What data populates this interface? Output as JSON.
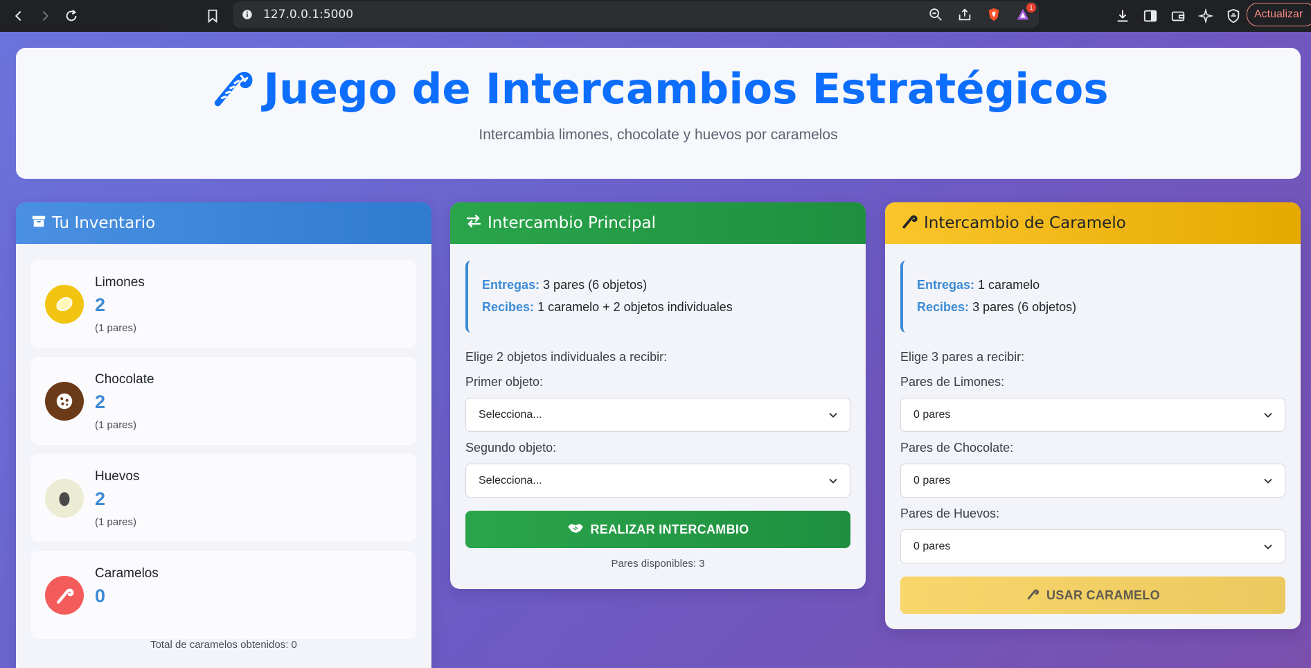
{
  "browser": {
    "url": "127.0.0.1:5000",
    "update_label": "Actualizar",
    "notification_count": "1"
  },
  "header": {
    "title": "Juego de Intercambios Estratégicos",
    "subtitle": "Intercambia limones, chocolate y huevos por caramelos"
  },
  "inventory": {
    "title": "Tu Inventario",
    "items": [
      {
        "name": "Limones",
        "count": "2",
        "pairs": "(1 pares)",
        "icon": "lemon-icon",
        "color": "#f1c40f"
      },
      {
        "name": "Chocolate",
        "count": "2",
        "pairs": "(1 pares)",
        "icon": "cookie-icon",
        "color": "#6b3a18"
      },
      {
        "name": "Huevos",
        "count": "2",
        "pairs": "(1 pares)",
        "icon": "egg-icon",
        "color": "#ecebd4"
      },
      {
        "name": "Caramelos",
        "count": "0",
        "pairs": "",
        "icon": "candy-cane-icon",
        "color": "#f45b5b"
      }
    ],
    "total": "Total de caramelos obtenidos: 0"
  },
  "main_exchange": {
    "title": "Intercambio Principal",
    "gives_key": "Entregas:",
    "gives_value": "3 pares (6 objetos)",
    "receives_key": "Recibes:",
    "receives_value": "1 caramelo + 2 objetos individuales",
    "choose_label": "Elige 2 objetos individuales a recibir:",
    "first_label": "Primer objeto:",
    "first_value": "Selecciona...",
    "second_label": "Segundo objeto:",
    "second_value": "Selecciona...",
    "button_label": "REALIZAR INTERCAMBIO",
    "pairs_available": "Pares disponibles: 3"
  },
  "candy_exchange": {
    "title": "Intercambio de Caramelo",
    "gives_key": "Entregas:",
    "gives_value": "1 caramelo",
    "receives_key": "Recibes:",
    "receives_value": "3 pares (6 objetos)",
    "choose_label": "Elige 3 pares a recibir:",
    "lemons_label": "Pares de Limones:",
    "lemons_value": "0 pares",
    "chocolate_label": "Pares de Chocolate:",
    "chocolate_value": "0 pares",
    "eggs_label": "Pares de Huevos:",
    "eggs_value": "0 pares",
    "button_label": "USAR CARAMELO"
  },
  "colors": {
    "brand_blue": "#0d6efd",
    "accent_blue": "#3d8bd6",
    "green": "#2aa54b",
    "yellow": "#fbc52b"
  }
}
